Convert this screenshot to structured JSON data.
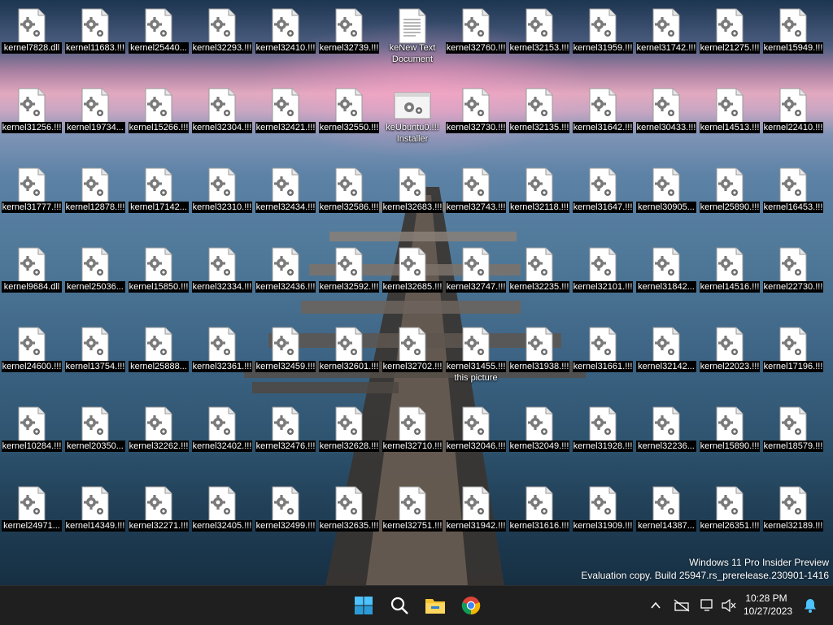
{
  "desktop": {
    "icons": [
      {
        "label": "kernel7828.dll",
        "type": "dll"
      },
      {
        "label": "kernel11683.!!!",
        "type": "dll"
      },
      {
        "label": "kernel25440...",
        "type": "dll"
      },
      {
        "label": "kernel32293.!!!",
        "type": "dll"
      },
      {
        "label": "kernel32410.!!!",
        "type": "dll"
      },
      {
        "label": "kernel32739.!!!",
        "type": "dll"
      },
      {
        "label": "keNew Text",
        "label2": "Document",
        "type": "text"
      },
      {
        "label": "kernel32760.!!!",
        "type": "dll"
      },
      {
        "label": "kernel32153.!!!",
        "type": "dll"
      },
      {
        "label": "kernel31959.!!!",
        "type": "dll"
      },
      {
        "label": "kernel31742.!!!",
        "type": "dll"
      },
      {
        "label": "kernel21275.!!!",
        "type": "dll"
      },
      {
        "label": "kernel15949.!!!",
        "type": "dll"
      },
      {
        "label": "kernel31256.!!!",
        "type": "dll"
      },
      {
        "label": "kernel19734...",
        "type": "dll"
      },
      {
        "label": "kernel15266.!!!",
        "type": "dll"
      },
      {
        "label": "kernel32304.!!!",
        "type": "dll"
      },
      {
        "label": "kernel32421.!!!",
        "type": "dll"
      },
      {
        "label": "kernel32550.!!!",
        "type": "dll"
      },
      {
        "label": "keUbuntu0.!!!",
        "label2": "Installer",
        "type": "installer"
      },
      {
        "label": "kernel32730.!!!",
        "type": "dll"
      },
      {
        "label": "kernel32135.!!!",
        "type": "dll"
      },
      {
        "label": "kernel31642.!!!",
        "type": "dll"
      },
      {
        "label": "kernel30433.!!!",
        "type": "dll"
      },
      {
        "label": "kernel14513.!!!",
        "type": "dll"
      },
      {
        "label": "kernel22410.!!!",
        "type": "dll"
      },
      {
        "label": "kernel31777.!!!",
        "type": "dll"
      },
      {
        "label": "kernel12878.!!!",
        "type": "dll"
      },
      {
        "label": "kernel17142...",
        "type": "dll"
      },
      {
        "label": "kernel32310.!!!",
        "type": "dll"
      },
      {
        "label": "kernel32434.!!!",
        "type": "dll"
      },
      {
        "label": "kernel32586.!!!",
        "type": "dll"
      },
      {
        "label": "kernel32683.!!!",
        "type": "dll"
      },
      {
        "label": "kernel32743.!!!",
        "type": "dll"
      },
      {
        "label": "kernel32118.!!!",
        "type": "dll"
      },
      {
        "label": "kernel31647.!!!",
        "type": "dll"
      },
      {
        "label": "kernel30905...",
        "type": "dll"
      },
      {
        "label": "kernel25890.!!!",
        "type": "dll"
      },
      {
        "label": "kernel16453.!!!",
        "type": "dll"
      },
      {
        "label": "kernel9684.dll",
        "type": "dll"
      },
      {
        "label": "kernel25036...",
        "type": "dll"
      },
      {
        "label": "kernel15850.!!!",
        "type": "dll"
      },
      {
        "label": "kernel32334.!!!",
        "type": "dll"
      },
      {
        "label": "kernel32436.!!!",
        "type": "dll"
      },
      {
        "label": "kernel32592.!!!",
        "type": "dll"
      },
      {
        "label": "kernel32685.!!!",
        "type": "dll"
      },
      {
        "label": "kernel32747.!!!",
        "type": "dll"
      },
      {
        "label": "kernel32235.!!!",
        "type": "dll"
      },
      {
        "label": "kernel32101.!!!",
        "type": "dll"
      },
      {
        "label": "kernel31842...",
        "type": "dll"
      },
      {
        "label": "kernel14516.!!!",
        "type": "dll"
      },
      {
        "label": "kernel22730.!!!",
        "type": "dll"
      },
      {
        "label": "kernel24600.!!!",
        "type": "dll"
      },
      {
        "label": "kernel13754.!!!",
        "type": "dll"
      },
      {
        "label": "kernel25888...",
        "type": "dll"
      },
      {
        "label": "kernel32361.!!!",
        "type": "dll"
      },
      {
        "label": "kernel32459.!!!",
        "type": "dll"
      },
      {
        "label": "kernel32601.!!!",
        "type": "dll"
      },
      {
        "label": "kernel32702.!!!",
        "type": "dll"
      },
      {
        "label": "kernel31455.!!!",
        "label2": "this picture",
        "type": "dll"
      },
      {
        "label": "kernel31938.!!!",
        "type": "dll"
      },
      {
        "label": "kernel31661.!!!",
        "type": "dll"
      },
      {
        "label": "kernel32142...",
        "type": "dll"
      },
      {
        "label": "kernel22023.!!!",
        "type": "dll"
      },
      {
        "label": "kernel17196.!!!",
        "type": "dll"
      },
      {
        "label": "kernel10284.!!!",
        "type": "dll"
      },
      {
        "label": "kernel20350...",
        "type": "dll"
      },
      {
        "label": "kernel32262.!!!",
        "type": "dll"
      },
      {
        "label": "kernel32402.!!!",
        "type": "dll"
      },
      {
        "label": "kernel32476.!!!",
        "type": "dll"
      },
      {
        "label": "kernel32628.!!!",
        "type": "dll"
      },
      {
        "label": "kernel32710.!!!",
        "type": "dll"
      },
      {
        "label": "kernel32046.!!!",
        "type": "dll"
      },
      {
        "label": "kernel32049.!!!",
        "type": "dll"
      },
      {
        "label": "kernel31928.!!!",
        "type": "dll"
      },
      {
        "label": "kernel32236...",
        "type": "dll"
      },
      {
        "label": "kernel15890.!!!",
        "type": "dll"
      },
      {
        "label": "kernel18579.!!!",
        "type": "dll"
      },
      {
        "label": "kernel24971...",
        "type": "dll"
      },
      {
        "label": "kernel14349.!!!",
        "type": "dll"
      },
      {
        "label": "kernel32271.!!!",
        "type": "dll"
      },
      {
        "label": "kernel32405.!!!",
        "type": "dll"
      },
      {
        "label": "kernel32499.!!!",
        "type": "dll"
      },
      {
        "label": "kernel32635.!!!",
        "type": "dll"
      },
      {
        "label": "kernel32751.!!!",
        "type": "dll"
      },
      {
        "label": "kernel31942.!!!",
        "type": "dll"
      },
      {
        "label": "kernel31616.!!!",
        "type": "dll"
      },
      {
        "label": "kernel31909.!!!",
        "type": "dll"
      },
      {
        "label": "kernel14387...",
        "type": "dll"
      },
      {
        "label": "kernel26351.!!!",
        "type": "dll"
      },
      {
        "label": "kernel32189.!!!",
        "type": "dll"
      }
    ]
  },
  "watermark": {
    "line1": "Windows 11 Pro Insider Preview",
    "line2": "Evaluation copy. Build 25947.rs_prerelease.230901-1416"
  },
  "taskbar": {
    "apps": [
      {
        "name": "start-button",
        "icon": "windows-logo-icon"
      },
      {
        "name": "search-button",
        "icon": "search-icon"
      },
      {
        "name": "file-explorer-button",
        "icon": "folder-icon"
      },
      {
        "name": "chrome-button",
        "icon": "chrome-icon"
      }
    ],
    "tray_icons": [
      "chevron-up-icon",
      "no-network-icon",
      "display-icon",
      "volume-muted-icon"
    ],
    "time": "10:28 PM",
    "date": "10/27/2023",
    "notification_icon": "bell-icon"
  },
  "colors": {
    "taskbar": "#1f1f1f",
    "accent": "#4cc2ff"
  }
}
